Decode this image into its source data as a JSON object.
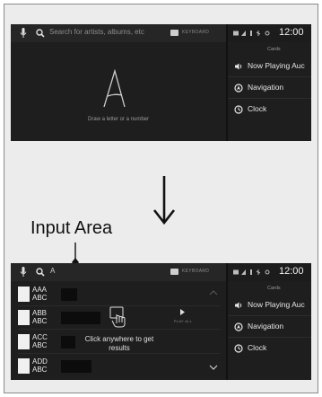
{
  "top_screen": {
    "search_placeholder": "Search for artists, albums, etc",
    "keyboard_label": "KEYBOARD",
    "clock": "12:00",
    "cards_header": "Cards",
    "cards": [
      {
        "label": "Now Playing Auc",
        "icon": "speaker-icon"
      },
      {
        "label": "Navigation",
        "icon": "navigation-icon"
      },
      {
        "label": "Clock",
        "icon": "clock-icon"
      }
    ],
    "draw_hint": "Draw a letter or a number"
  },
  "annotation": {
    "input_area_label": "Input Area"
  },
  "bottom_screen": {
    "typed_text": "A",
    "keyboard_label": "KEYBOARD",
    "clock": "12:00",
    "cards_header": "Cards",
    "cards": [
      {
        "label": "Now Playing Auc",
        "icon": "speaker-icon"
      },
      {
        "label": "Navigation",
        "icon": "navigation-icon"
      },
      {
        "label": "Clock",
        "icon": "clock-icon"
      }
    ],
    "results": [
      {
        "line1": "AAA",
        "line2": "ABC"
      },
      {
        "line1": "ABB",
        "line2": "ABC"
      },
      {
        "line1": "ACC",
        "line2": "ABC"
      },
      {
        "line1": "ADD",
        "line2": "ABC"
      }
    ],
    "play_all_label": "PLAY ALL",
    "hint_text": "Click anywhere to get results"
  },
  "colors": {
    "screen_bg": "#1e1e1e",
    "frame_bg": "#ececec",
    "text": "#e8e8e8"
  }
}
